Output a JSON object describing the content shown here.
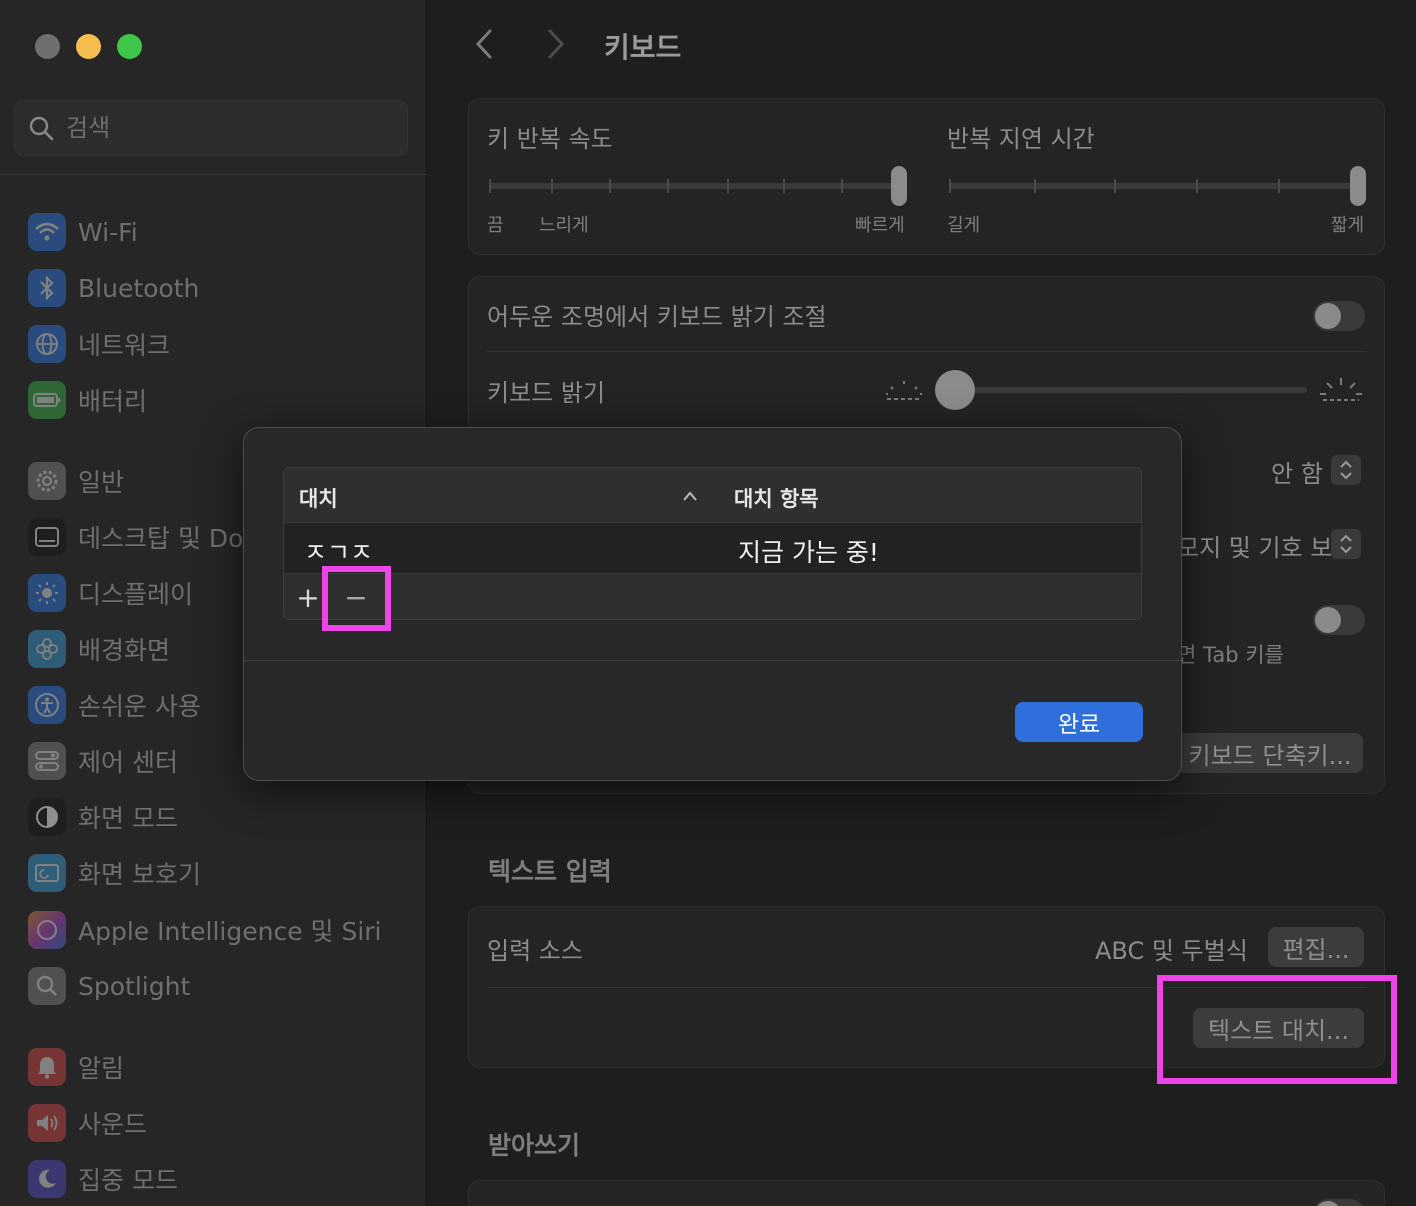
{
  "sidebar": {
    "search_placeholder": "검색",
    "items": [
      {
        "label": "Wi-Fi",
        "icon": "wifi-icon",
        "color": "#2f7ff6"
      },
      {
        "label": "Bluetooth",
        "icon": "bluetooth-icon",
        "color": "#2f7ff6"
      },
      {
        "label": "네트워크",
        "icon": "globe-icon",
        "color": "#2f7ff6"
      },
      {
        "label": "배터리",
        "icon": "battery-icon",
        "color": "#3dbf4a"
      },
      {
        "label": "일반",
        "icon": "gear-icon",
        "color": "#8a8a8a"
      },
      {
        "label": "데스크탑 및 Dock",
        "icon": "dock-icon",
        "color": "#1c1c1c"
      },
      {
        "label": "디스플레이",
        "icon": "sun-icon",
        "color": "#2f7ff6"
      },
      {
        "label": "배경화면",
        "icon": "flower-icon",
        "color": "#37a9e8"
      },
      {
        "label": "손쉬운 사용",
        "icon": "accessibility-icon",
        "color": "#2f7ff6"
      },
      {
        "label": "제어 센터",
        "icon": "toggles-icon",
        "color": "#8a8a8a"
      },
      {
        "label": "화면 모드",
        "icon": "appearance-icon",
        "color": "#1c1c1c"
      },
      {
        "label": "화면 보호기",
        "icon": "screensaver-icon",
        "color": "#37a9e8"
      },
      {
        "label": "Apple Intelligence 및 Siri",
        "icon": "siri-icon",
        "color": "#c44ad8"
      },
      {
        "label": "Spotlight",
        "icon": "magnifier-icon",
        "color": "#8a8a8a"
      },
      {
        "label": "알림",
        "icon": "bell-icon",
        "color": "#e54848"
      },
      {
        "label": "사운드",
        "icon": "speaker-icon",
        "color": "#e54848"
      },
      {
        "label": "집중 모드",
        "icon": "moon-icon",
        "color": "#5a4fd8"
      }
    ]
  },
  "header": {
    "title": "키보드"
  },
  "repeat": {
    "rate_title": "키 반복 속도",
    "rate_labels": [
      "끔",
      "느리게",
      "빠르게"
    ],
    "delay_title": "반복 지연 시간",
    "delay_labels": [
      "길게",
      "짧게"
    ]
  },
  "backlight": {
    "auto_label": "어두운 조명에서 키보드 밝기 조절",
    "brightness_label": "키보드 밝기",
    "off_value": "안 함",
    "emoji_value_partial": "모지 및 기호 보기",
    "tab_text_partial": "면 Tab 키를",
    "shortcut_button": "키보드 단축키..."
  },
  "text_input": {
    "section_title": "텍스트 입력",
    "input_sources_label": "입력 소스",
    "input_sources_value": "ABC 및 두벌식",
    "edit_button": "편집...",
    "text_replace_button": "텍스트 대치..."
  },
  "dictation": {
    "section_title": "받아쓰기"
  },
  "dialog": {
    "col_replace": "대치",
    "col_with": "대치 항목",
    "rows": [
      {
        "replace": "ㅈㄱㅈ",
        "with": "지금 가는 중!"
      }
    ],
    "add_label": "+",
    "remove_label": "−",
    "done_button": "완료"
  },
  "colors": {
    "accent": "#2f6fdb",
    "highlight": "#ee44ea"
  }
}
